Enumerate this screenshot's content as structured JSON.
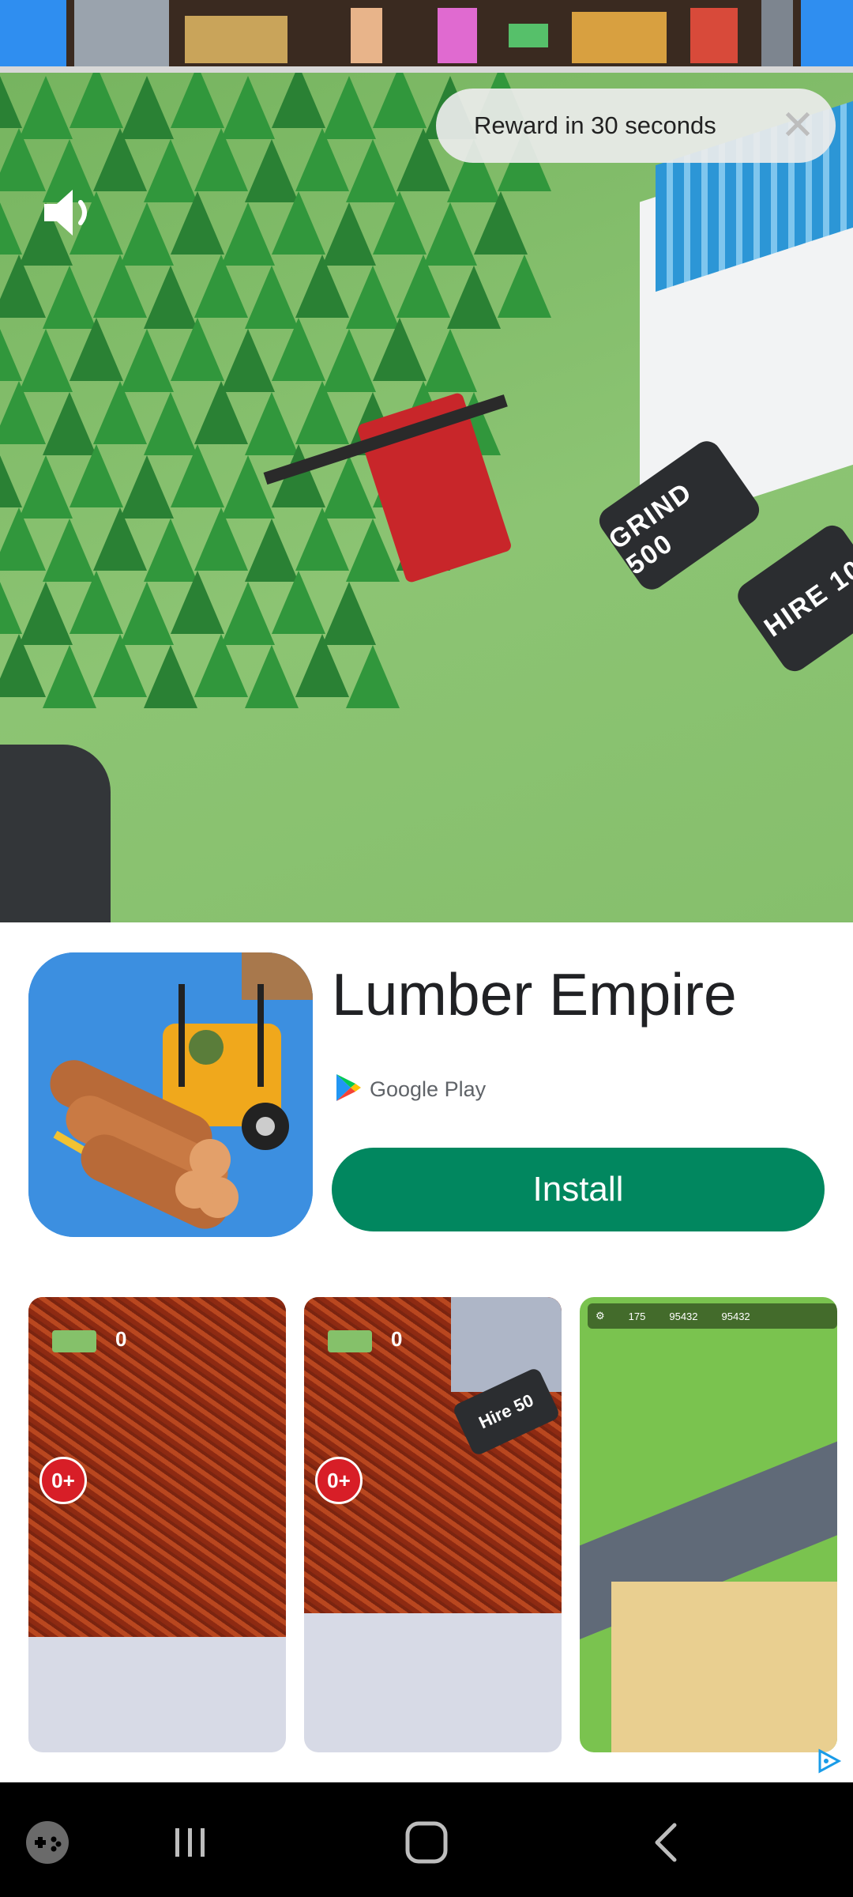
{
  "ad": {
    "reward_text": "Reward in 30 seconds",
    "close_icon": "close-icon",
    "sound_icon": "speaker-icon",
    "scene_pads": [
      "GRIND 500",
      "HIRE 10"
    ]
  },
  "app": {
    "title": "Lumber Empire",
    "store_label": "Google Play",
    "install_label": "Install"
  },
  "screenshots": [
    {
      "cash": "0",
      "age_badge": "0+"
    },
    {
      "cash": "0",
      "age_badge": "0+",
      "sign": "Hire 50"
    },
    {
      "hud_values": [
        "175",
        "95432",
        "95432"
      ]
    }
  ],
  "navbar": {
    "icons": [
      "game-launcher-icon",
      "recent-apps-icon",
      "home-icon",
      "back-icon"
    ]
  },
  "colors": {
    "install": "#01875f",
    "top_strip": "#2f8ef0",
    "grass": "#86bf6c"
  }
}
